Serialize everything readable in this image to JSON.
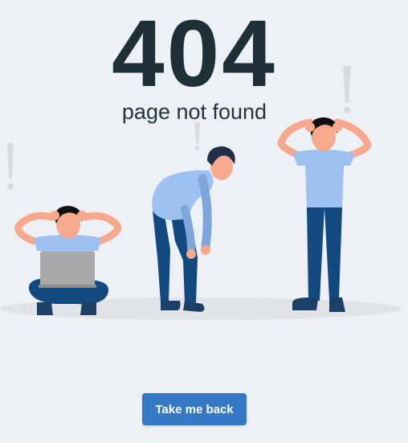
{
  "error": {
    "code": "404",
    "message": "page not found"
  },
  "actions": {
    "back_label": "Take me back"
  },
  "colors": {
    "background": "#edf1f6",
    "heading": "#1f2f38",
    "button": "#3478c6",
    "shirt": "#9ec1f1",
    "pants": "#124a80",
    "skin": "#f6a98c",
    "hair": "#111111"
  },
  "illustration": {
    "figures": [
      "man-sitting-with-laptop",
      "man-bent-over-tired",
      "man-holding-head"
    ],
    "decorations": [
      "exclamation-mark",
      "exclamation-mark",
      "exclamation-mark"
    ]
  }
}
